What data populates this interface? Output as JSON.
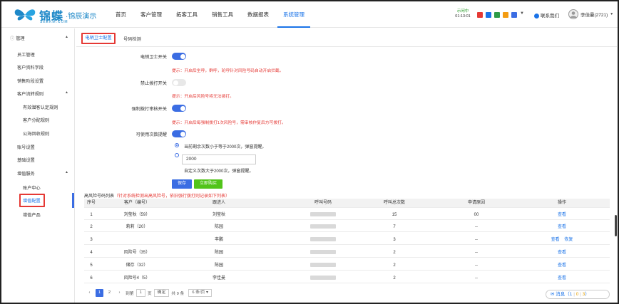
{
  "logo": {
    "brand": "锦蝶",
    "sub": "·锦辰演示",
    "url": "SEEKM.COM"
  },
  "nav": [
    {
      "label": "首页",
      "active": false
    },
    {
      "label": "客户管理",
      "active": false
    },
    {
      "label": "拓客工具",
      "active": false
    },
    {
      "label": "销售工具",
      "active": false
    },
    {
      "label": "数据报表",
      "active": false
    },
    {
      "label": "系统管理",
      "active": true
    }
  ],
  "clock": {
    "status": "示闲中",
    "time": "01:13:01"
  },
  "status_icons": [
    "#e53935",
    "#1a73e8",
    "#2e9b48",
    "#f39c12",
    "#3b6de3"
  ],
  "contact": "联系我们",
  "user": {
    "name": "李佳曼(2721)"
  },
  "sidebar": {
    "section": "管理",
    "items": [
      {
        "label": "员工管理"
      },
      {
        "label": "客户资料字段"
      },
      {
        "label": "销售阶段设置"
      },
      {
        "label": "客户流转规则"
      },
      {
        "label": "有效潜客认定规则"
      },
      {
        "label": "客户分配规则"
      },
      {
        "label": "公海回收规则"
      },
      {
        "label": "账号设置"
      },
      {
        "label": "基础设置"
      },
      {
        "label": "增值服务"
      },
      {
        "label": "账户中心"
      },
      {
        "label": "增值配置"
      },
      {
        "label": "增值产品"
      }
    ]
  },
  "tabs": {
    "tab1": "电销卫士配置",
    "tab2": "号码检测"
  },
  "form": {
    "f1_label": "电销卫士开关",
    "f1_hint": "提示：开启后坐呼，群呼，轮呼针对风险号码自动开启拦截。",
    "f2_label": "禁止拨打开关",
    "f2_hint": "提示：开启后风险号将无法拨打。",
    "f3_label": "强制拨打审核开关",
    "f3_hint": "提示：开启后每强制拨打1次风险号，需审核作复后方可拨打。",
    "f4_label": "可使用次数提醒",
    "radio1": "当前剩余次数小于等于2000次，弹窗提醒。",
    "input_value": "2000",
    "radio2": "自定义次数大于2000次，弹窗提醒。",
    "save": "保存",
    "buy": "立即购买"
  },
  "list": {
    "title": "高风险号码列表",
    "note": "（针对系统检测出高风险号，依旧强行拨打则记录如下列表）"
  },
  "table": {
    "headers": [
      "序号",
      "客户（编号）",
      "跟进人",
      "呼叫号码",
      "呼叫总次数",
      "申请原因",
      "操作"
    ],
    "rows": [
      {
        "no": "1",
        "customer": "刘莹秋（59）",
        "owner": "刘莹秋",
        "count": "15",
        "reason": "00",
        "actions": [
          "查看"
        ]
      },
      {
        "no": "2",
        "customer": "莉莉（20）",
        "owner": "陈园",
        "count": "7",
        "reason": "--",
        "actions": [
          "查看"
        ]
      },
      {
        "no": "3",
        "customer": "",
        "owner": "丰鹏",
        "count": "3",
        "reason": "--",
        "actions": [
          "查看",
          "恢复"
        ]
      },
      {
        "no": "4",
        "customer": "风险号（35）",
        "owner": "陈园",
        "count": "2",
        "reason": "--",
        "actions": [
          "查看"
        ]
      },
      {
        "no": "5",
        "customer": "储存（32）",
        "owner": "陈园",
        "count": "2",
        "reason": "--",
        "actions": [
          "查看"
        ]
      },
      {
        "no": "6",
        "customer": "风险号4（5）",
        "owner": "李佳曼",
        "count": "2",
        "reason": "--",
        "actions": [
          "查看"
        ]
      }
    ]
  },
  "pager": {
    "p1": "1",
    "p2": "2",
    "goto": "到第",
    "page_value": "1",
    "page_unit": "页",
    "confirm": "确定",
    "total": "共 9 条",
    "size": "6 条/页"
  },
  "messages": {
    "label": "消息（",
    "a": "1",
    "sep1": "|",
    "b": "0",
    "sep2": "|",
    "c": "3",
    "end": "）"
  }
}
